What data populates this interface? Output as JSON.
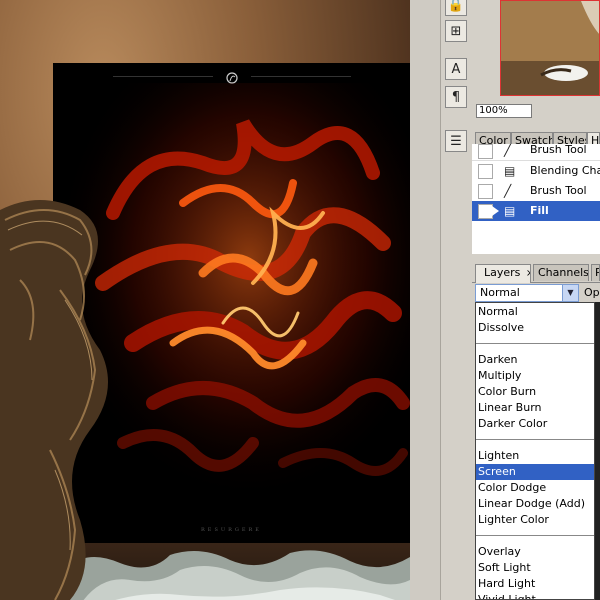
{
  "navigator": {
    "zoom_value": "100%"
  },
  "history": {
    "tabs": [
      "Color",
      "Swatch",
      "Styles",
      "H"
    ],
    "items": [
      {
        "label": "Brush Tool",
        "icon": "brush-icon",
        "selected": false
      },
      {
        "label": "Blending Chang",
        "icon": "document-icon",
        "selected": false
      },
      {
        "label": "Brush Tool",
        "icon": "brush-icon",
        "selected": false
      },
      {
        "label": "Fill",
        "icon": "fill-icon",
        "selected": true
      }
    ]
  },
  "layers": {
    "tabs": [
      "Layers",
      "Channels",
      "P"
    ],
    "close_glyph": "×",
    "blend_mode_value": "Normal",
    "opacity_label": "Opa"
  },
  "blend_modes": {
    "groups": [
      [
        "Normal",
        "Dissolve"
      ],
      [
        "Darken",
        "Multiply",
        "Color Burn",
        "Linear Burn",
        "Darker Color"
      ],
      [
        "Lighten",
        "Screen",
        "Color Dodge",
        "Linear Dodge (Add)",
        "Lighter Color"
      ],
      [
        "Overlay",
        "Soft Light",
        "Hard Light",
        "Vivid Light"
      ]
    ],
    "highlighted": "Screen"
  },
  "poster": {
    "footer_text": "RESURGERE"
  },
  "colors": {
    "selection_blue": "#3161c4",
    "panel_gray": "#d4d0c8",
    "navigator_border": "#dd3333"
  }
}
